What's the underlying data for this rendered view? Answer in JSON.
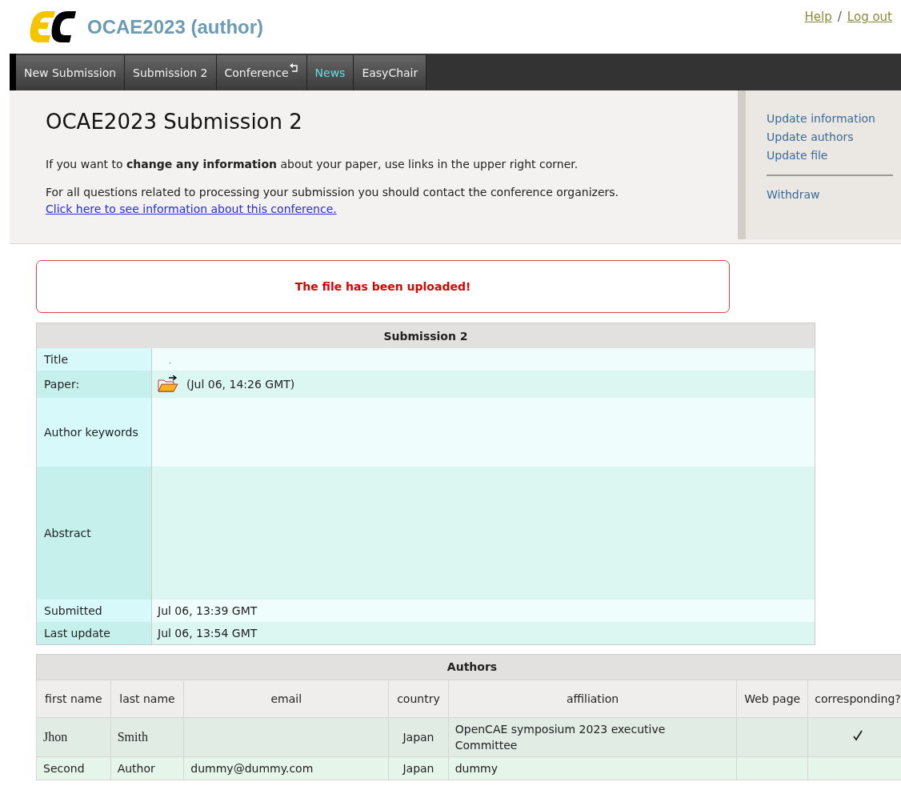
{
  "header": {
    "title": "OCAE2023 (author)",
    "links": [
      "Help",
      "Log out"
    ],
    "separator": "/"
  },
  "nav": {
    "tabs": [
      {
        "label": "New Submission",
        "selected": false
      },
      {
        "label": "Submission 2",
        "selected": false
      },
      {
        "label": "Conference",
        "selected": false,
        "has_submenu": true
      },
      {
        "label": "News",
        "selected": true
      },
      {
        "label": "EasyChair",
        "selected": false
      }
    ]
  },
  "intro": {
    "heading": "OCAE2023 Submission 2",
    "paragraph": "If you want to **change any information** about your paper, use links in the upper right corner.",
    "contact_text": "For all questions related to processing your submission you should contact the conference organizers.",
    "contact_link": "Click here to see information about this conference."
  },
  "side_menu": {
    "items": [
      "Update information",
      "Update authors",
      "Update file"
    ],
    "after_divider": [
      "Withdraw"
    ]
  },
  "message": "The file has been uploaded!",
  "submission": {
    "caption": "Submission 2",
    "rows": [
      {
        "kind": "text",
        "label": "Title",
        "value": "."
      },
      {
        "kind": "file",
        "label": "Paper:",
        "value": "(Jul 06, 14:26 GMT)"
      },
      {
        "kind": "block",
        "label": "Author keywords",
        "value": ""
      },
      {
        "kind": "tall",
        "label": "Abstract",
        "value": ""
      },
      {
        "kind": "text",
        "label": "Submitted",
        "value": "Jul 06, 13:39 GMT"
      },
      {
        "kind": "text",
        "label": "Last update",
        "value": "Jul 06, 13:54 GMT"
      }
    ]
  },
  "authors": {
    "caption": "Authors",
    "columns": [
      "first name",
      "last name",
      "email",
      "country",
      "affiliation",
      "Web page",
      "corresponding?"
    ],
    "rows": [
      {
        "first": "Jhon",
        "last": "Smith",
        "email": "",
        "country": "Japan",
        "affiliation": "OpenCAE symposium 2023 executive Committee",
        "corresponding": true,
        "kind": "serif"
      },
      {
        "first": "Second",
        "last": "Author",
        "email": "dummy@dummy.com",
        "country": "Japan",
        "affiliation": "dummy",
        "corresponding": false,
        "kind": "plain"
      }
    ]
  }
}
